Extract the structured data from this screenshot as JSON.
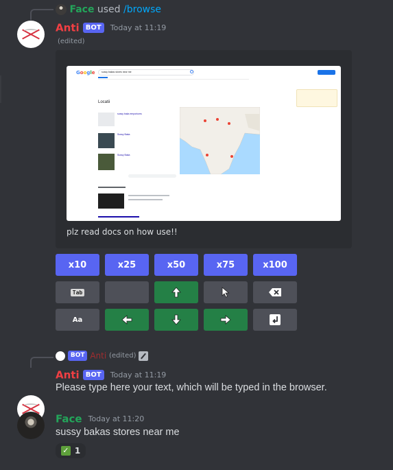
{
  "reply1": {
    "username": "Face",
    "action": "used",
    "command": "/browse"
  },
  "msg1": {
    "username": "Anti",
    "bot_tag": "BOT",
    "timestamp": "Today at 11:19",
    "edited": "(edited)",
    "embed_description": "plz read docs on how use!!",
    "screenshot": {
      "search_query": "sussy bakas stores near me",
      "section_heading": "Locatii",
      "places": [
        "sussy baka emporiums",
        "Sussy Baka",
        "Sussy Baka"
      ],
      "map_color": "#aadaff",
      "land_color": "#f2efe9"
    }
  },
  "buttons": {
    "row1": [
      "x10",
      "x25",
      "x50",
      "x75",
      "x100"
    ],
    "tab_label": "Tab",
    "aa_label": "Aa"
  },
  "reply2": {
    "bot_tag": "BOT",
    "username": "Anti",
    "edited": "(edited)"
  },
  "msg2": {
    "username": "Anti",
    "bot_tag": "BOT",
    "timestamp": "Today at 11:19",
    "content": "Please type here your text, which will be typed in the browser."
  },
  "msg3": {
    "username": "Face",
    "timestamp": "Today at 11:20",
    "content": "sussy bakas stores near me",
    "reaction_count": "1"
  },
  "colors": {
    "anti_name": "#f23f43",
    "face_name": "#23a55a",
    "blurple": "#5865f2",
    "green_button": "#248046",
    "grey_button": "#4e5058",
    "link": "#00a8fc"
  }
}
